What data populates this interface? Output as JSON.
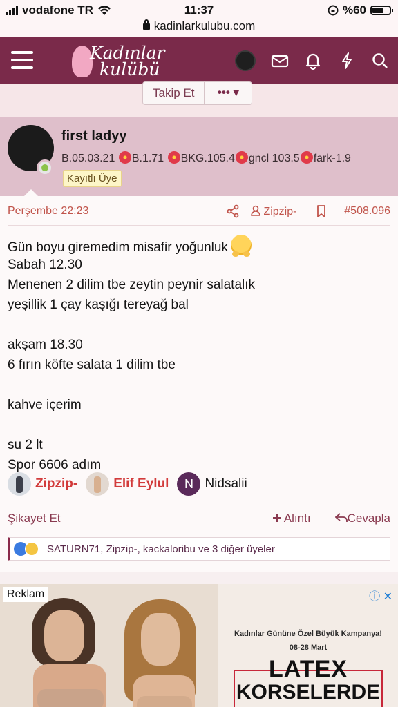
{
  "status_bar": {
    "carrier": "vodafone TR",
    "time": "11:37",
    "battery": "%60",
    "battery_level": 0.6
  },
  "url_bar": {
    "url": "kadinlarkulubu.com"
  },
  "header": {
    "logo_line1": "Kadınlar",
    "logo_line2": "kulübü",
    "brand_color": "#7a2a4a"
  },
  "follow": {
    "follow_label": "Takip Et",
    "more_label": "••• ▾"
  },
  "user": {
    "name": "first ladyy",
    "stats": [
      "B.05.03.21",
      "B.1.71",
      "BKG.105.4",
      "gncl 103.5",
      "fark-1.9"
    ],
    "badge": "Kayıtlı Üye"
  },
  "post": {
    "date": "Perşembe 22:23",
    "author": "Zipzip-",
    "post_number": "#508.096",
    "lines": [
      "Gün boyu giremedim misafir yoğunluk",
      "Sabah 12.30",
      "Menenen 2 dilim tbe zeytin peynir salatalık",
      "yeşillik 1 çay kaşığı tereyağ bal",
      "",
      "akşam 18.30",
      "6 fırın köfte salata 1 dilim tbe",
      "",
      "kahve içerim",
      "",
      "su 2 lt",
      "Spor 6606 adım"
    ],
    "reactors": [
      {
        "name": "Zipzip-"
      },
      {
        "name": "Elif Eylul"
      },
      {
        "name": "Nidsalii",
        "initial": "N"
      }
    ],
    "actions": {
      "report": "Şikayet Et",
      "quote": "Alıntı",
      "reply": "Cevapla"
    },
    "reactions_summary": "SATURN71, Zipzip-, kackaloribu ve 3 diğer üyeler"
  },
  "ad": {
    "label": "Reklam",
    "campaign": "Kadınlar Gününe Özel Büyük Kampanya!",
    "dates": "08-28 Mart",
    "headline1": "LATEX",
    "headline2": "KORSELERDE"
  }
}
